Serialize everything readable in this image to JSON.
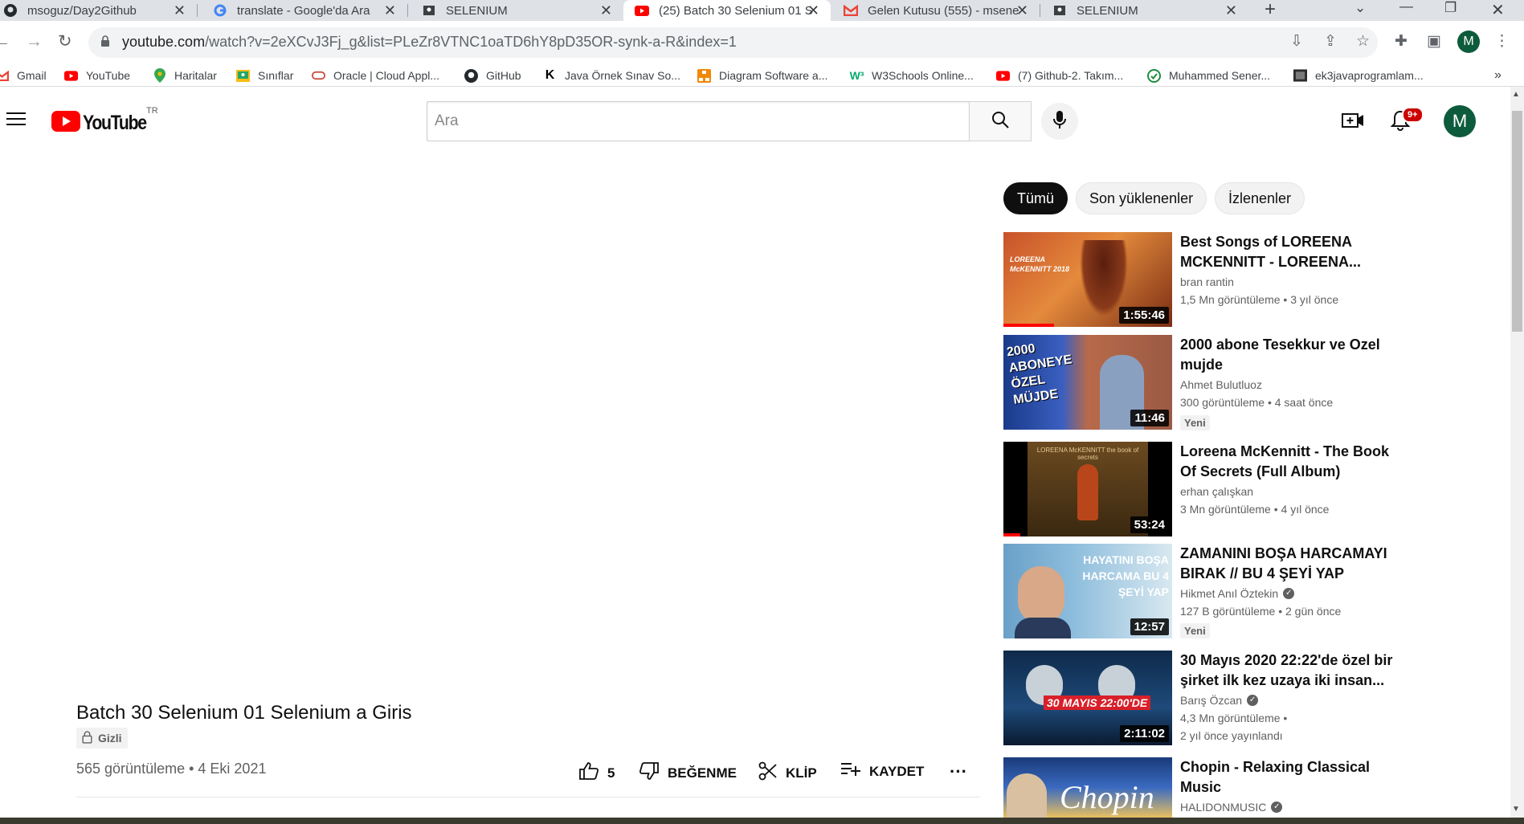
{
  "browser": {
    "tabs": [
      {
        "title": "msoguz/Day2Github",
        "icon": "github-icon",
        "active": false
      },
      {
        "title": "translate - Google'da Ara",
        "icon": "google-icon",
        "active": false
      },
      {
        "title": "SELENIUM",
        "icon": "classroom-icon",
        "active": false
      },
      {
        "title": "(25) Batch 30 Selenium 01 S",
        "icon": "youtube-icon",
        "active": true
      },
      {
        "title": "Gelen Kutusu (555) - msene",
        "icon": "gmail-icon",
        "active": false
      },
      {
        "title": "SELENIUM",
        "icon": "classroom-icon",
        "active": false
      }
    ],
    "new_tab": "+",
    "url_host": "youtube.com",
    "url_path": "/watch?v=2eXCvJ3Fj_g&list=PLeZr8VTNC1oaTD6hY8pD35OR-synk-a-R&index=1",
    "profile_initial": "M",
    "bookmarks": [
      {
        "label": "Gmail",
        "icon": "gmail-icon"
      },
      {
        "label": "YouTube",
        "icon": "youtube-icon"
      },
      {
        "label": "Haritalar",
        "icon": "maps-icon"
      },
      {
        "label": "Sınıflar",
        "icon": "classroom-icon"
      },
      {
        "label": "Oracle | Cloud Appl...",
        "icon": "oracle-icon"
      },
      {
        "label": "GitHub",
        "icon": "github-icon"
      },
      {
        "label": "Java Örnek Sınav So...",
        "icon": "k-icon"
      },
      {
        "label": "Diagram Software a...",
        "icon": "diagram-icon"
      },
      {
        "label": "W3Schools Online...",
        "icon": "w3schools-icon"
      },
      {
        "label": "(7) Github-2. Takım...",
        "icon": "youtube-icon"
      },
      {
        "label": "Muhammed Sener...",
        "icon": "check-icon"
      },
      {
        "label": "ek3javaprogramlam...",
        "icon": "image-icon"
      }
    ],
    "more_bookmarks": "»"
  },
  "youtube": {
    "logo_text": "YouTube",
    "region": "TR",
    "search_placeholder": "Ara",
    "notification_count": "9+",
    "avatar_initial": "M"
  },
  "video": {
    "title": "Batch 30 Selenium 01 Selenium a Giris",
    "privacy": "Gizli",
    "views_date": "565 görüntüleme • 4 Eki 2021",
    "likes": "5",
    "dislike_label": "BEĞENME",
    "clip_label": "KLİP",
    "save_label": "KAYDET",
    "more": "···"
  },
  "chips": [
    "Tümü",
    "Son yüklenenler",
    "İzlenenler"
  ],
  "recommendations": [
    {
      "title": "Best Songs of LOREENA MCKENNITT - LOREENA...",
      "channel": "bran rantin",
      "verified": false,
      "meta": "1,5 Mn görüntüleme • 3 yıl önce",
      "duration": "1:55:46",
      "new": "",
      "progress": 0.3,
      "thumb_text": "LOREENA McKENNITT 2018"
    },
    {
      "title": "2000 abone Tesekkur ve Ozel mujde",
      "channel": "Ahmet Bulutluoz",
      "verified": false,
      "meta": "300 görüntüleme • 4 saat önce",
      "duration": "11:46",
      "new": "Yeni",
      "progress": 0,
      "thumb_text": "2000 ABONEYE ÖZEL MÜJDE"
    },
    {
      "title": "Loreena McKennitt - The Book Of Secrets (Full Album)",
      "channel": "erhan çalışkan",
      "verified": false,
      "meta": "3 Mn görüntüleme • 4 yıl önce",
      "duration": "53:24",
      "new": "",
      "progress": 0.1,
      "thumb_text": "LOREENA McKENNITT the book of secrets"
    },
    {
      "title": "ZAMANINI BOŞA HARCAMAYI BIRAK // BU 4 ŞEYİ YAP",
      "channel": "Hikmet Anıl Öztekin",
      "verified": true,
      "meta": "127 B görüntüleme • 2 gün önce",
      "duration": "12:57",
      "new": "Yeni",
      "progress": 0,
      "thumb_text": "HAYATINI BOŞA HARCAMA BU 4 ŞEYİ YAP"
    },
    {
      "title": "30 Mayıs 2020 22:22'de özel bir şirket ilk kez uzaya iki insan...",
      "channel": "Barış Özcan",
      "verified": true,
      "meta": "4,3 Mn görüntüleme •",
      "meta2": "2 yıl önce yayınlandı",
      "duration": "2:11:02",
      "new": "",
      "progress": 0,
      "thumb_text": "30 MAYIS 22:00'DE"
    },
    {
      "title": "Chopin - Relaxing Classical Music",
      "channel": "HALIDONMUSIC",
      "verified": true,
      "meta": "",
      "duration": "",
      "new": "",
      "progress": 0,
      "thumb_text": "Chopin"
    }
  ]
}
